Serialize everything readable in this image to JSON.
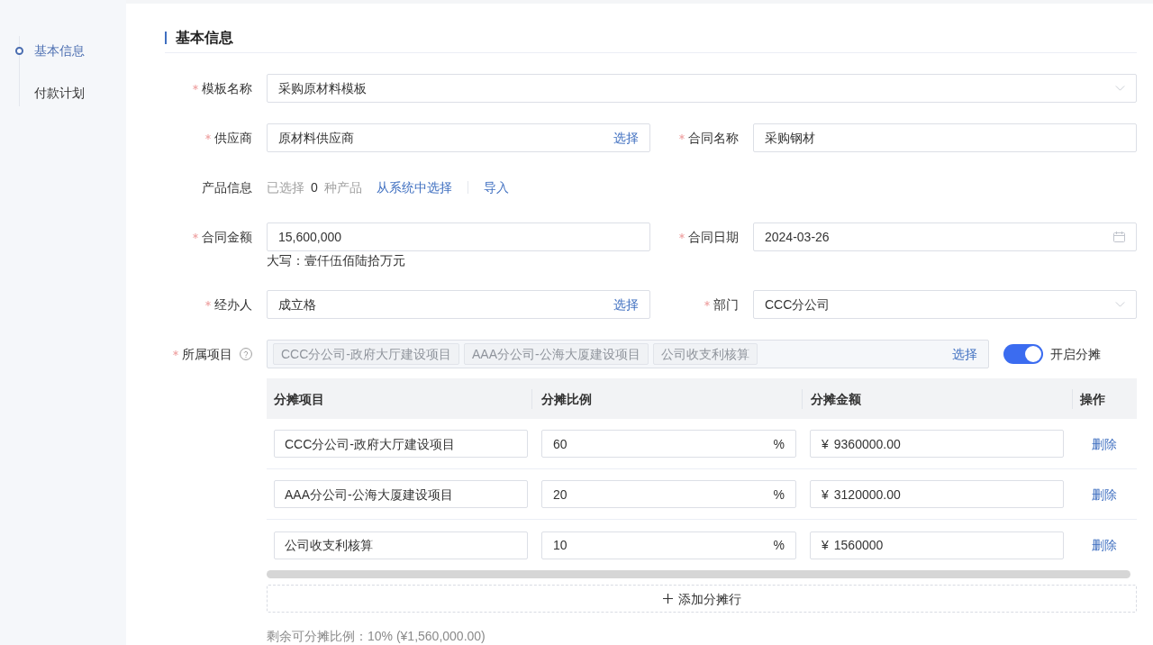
{
  "sidebar": {
    "items": [
      {
        "label": "基本信息",
        "selected": true
      },
      {
        "label": "付款计划",
        "selected": false
      }
    ]
  },
  "section": {
    "title": "基本信息"
  },
  "form_rows": [
    [
      {
        "kind": "select",
        "label": "模板名称",
        "required": true,
        "value": "采购原材料模板"
      }
    ],
    [
      {
        "kind": "picker",
        "label": "供应商",
        "required": true,
        "value": "原材料供应商",
        "action": "选择"
      },
      {
        "kind": "input",
        "label": "合同名称",
        "required": true,
        "value": "采购钢材"
      }
    ],
    [
      {
        "kind": "products",
        "label": "产品信息",
        "required": false,
        "prefix": "已选择",
        "count": "0",
        "suffix": "种产品",
        "links": [
          "从系统中选择",
          "导入"
        ]
      }
    ],
    [
      {
        "kind": "input",
        "label": "合同金额",
        "required": true,
        "value": "15,600,000",
        "hint": "大写：壹仟伍佰陆拾万元"
      },
      {
        "kind": "date",
        "label": "合同日期",
        "required": true,
        "value": "2024-03-26"
      }
    ],
    [
      {
        "kind": "picker",
        "label": "经办人",
        "required": true,
        "value": "成立格",
        "action": "选择"
      },
      {
        "kind": "select",
        "label": "部门",
        "required": true,
        "value": "CCC分公司"
      }
    ],
    [
      {
        "kind": "tags",
        "label": "所属项目",
        "required": true,
        "help": true,
        "tags": [
          "CCC分公司-政府大厅建设项目",
          "AAA分公司-公海大厦建设项目",
          "公司收支利核算"
        ],
        "action": "选择",
        "toggle": {
          "label": "开启分摊",
          "on": true
        }
      }
    ]
  ],
  "allocation_table": {
    "columns": [
      "分摊项目",
      "分摊比例",
      "分摊金额",
      "操作"
    ],
    "rows": [
      {
        "project": "CCC分公司-政府大厅建设项目",
        "ratio": "60",
        "unit": "%",
        "currency": "¥",
        "amount": "9360000.00",
        "action": "删除"
      },
      {
        "project": "AAA分公司-公海大厦建设项目",
        "ratio": "20",
        "unit": "%",
        "currency": "¥",
        "amount": "3120000.00",
        "action": "删除"
      },
      {
        "project": "公司收支利核算",
        "ratio": "10",
        "unit": "%",
        "currency": "¥",
        "amount": "1560000",
        "action": "删除"
      }
    ]
  },
  "add_row_button": {
    "label": "添加分摊行"
  },
  "remaining": "剩余可分摊比例：10% (¥1,560,000.00)"
}
